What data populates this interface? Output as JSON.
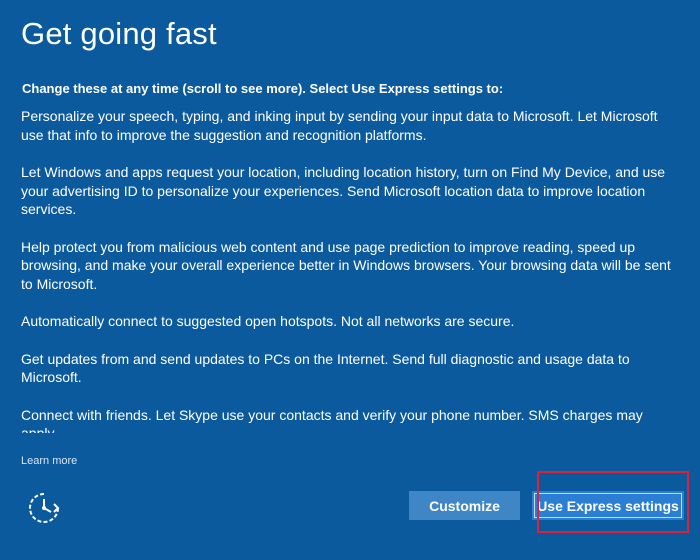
{
  "page": {
    "title": "Get going fast",
    "intro": "Change these at any time (scroll to see more). Select Use Express settings to:",
    "paragraphs": [
      "Personalize your speech, typing, and inking input by sending your input data to Microsoft. Let Microsoft use that info to improve the suggestion and recognition platforms.",
      "Let Windows and apps request your location, including location history, turn on Find My Device, and use your advertising ID to personalize your experiences. Send Microsoft location data to improve location services.",
      "Help protect you from malicious web content and use page prediction to improve reading, speed up browsing, and make your overall experience better in Windows browsers. Your browsing data will be sent to Microsoft.",
      "Automatically connect to suggested open hotspots. Not all networks are secure.",
      "Get updates from and send updates to PCs on the Internet. Send full diagnostic and usage data to Microsoft.",
      "Connect with friends. Let Skype use your contacts and verify your phone number. SMS charges may apply."
    ],
    "learn_more": "Learn more"
  },
  "footer": {
    "accessibility_icon": "ease-of-access-icon",
    "customize_label": "Customize",
    "express_label": "Use Express settings"
  },
  "colors": {
    "background": "#0b5a9e",
    "customize_button": "#3f86c6",
    "express_button": "#2a7fd4",
    "highlight": "#e0203a"
  }
}
